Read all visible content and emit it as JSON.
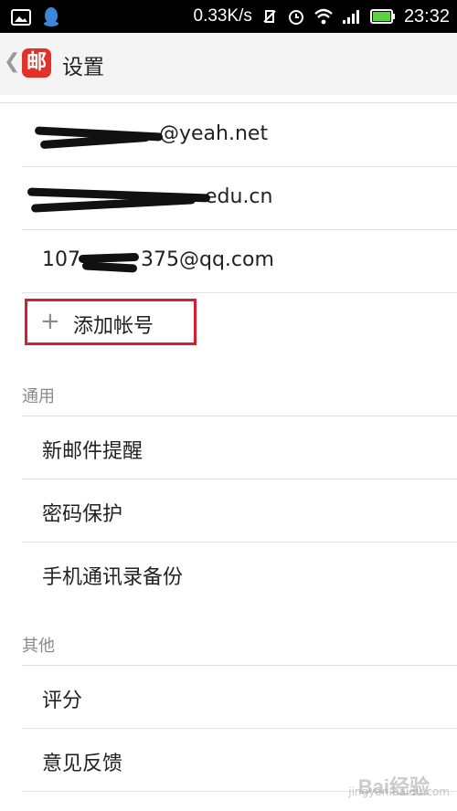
{
  "status_bar": {
    "speed": "0.33K/s",
    "time": "23:32",
    "icons": [
      "image-icon",
      "qq-icon",
      "no-signal-icon",
      "alarm-icon",
      "wifi-icon",
      "signal-icon",
      "battery-icon"
    ]
  },
  "header": {
    "back_glyph": "❮",
    "logo_text": "邮",
    "title": "设置"
  },
  "accounts": [
    {
      "visible_text": "@yeah.net"
    },
    {
      "visible_text": "edu.cn"
    },
    {
      "prefix": "107",
      "suffix": "375@qq.com"
    }
  ],
  "add_account": {
    "plus": "+",
    "label": "添加帐号"
  },
  "sections": {
    "general": {
      "title": "通用",
      "items": [
        "新邮件提醒",
        "密码保护",
        "手机通讯录备份"
      ]
    },
    "other": {
      "title": "其他",
      "items": [
        "评分",
        "意见反馈"
      ]
    }
  },
  "watermark": {
    "text": "Bai经验",
    "sub": "jingyan.baidu.com"
  },
  "colors": {
    "accent_red": "#d6202d",
    "logo_red": "#e0322b",
    "status_bar": "#000000"
  }
}
